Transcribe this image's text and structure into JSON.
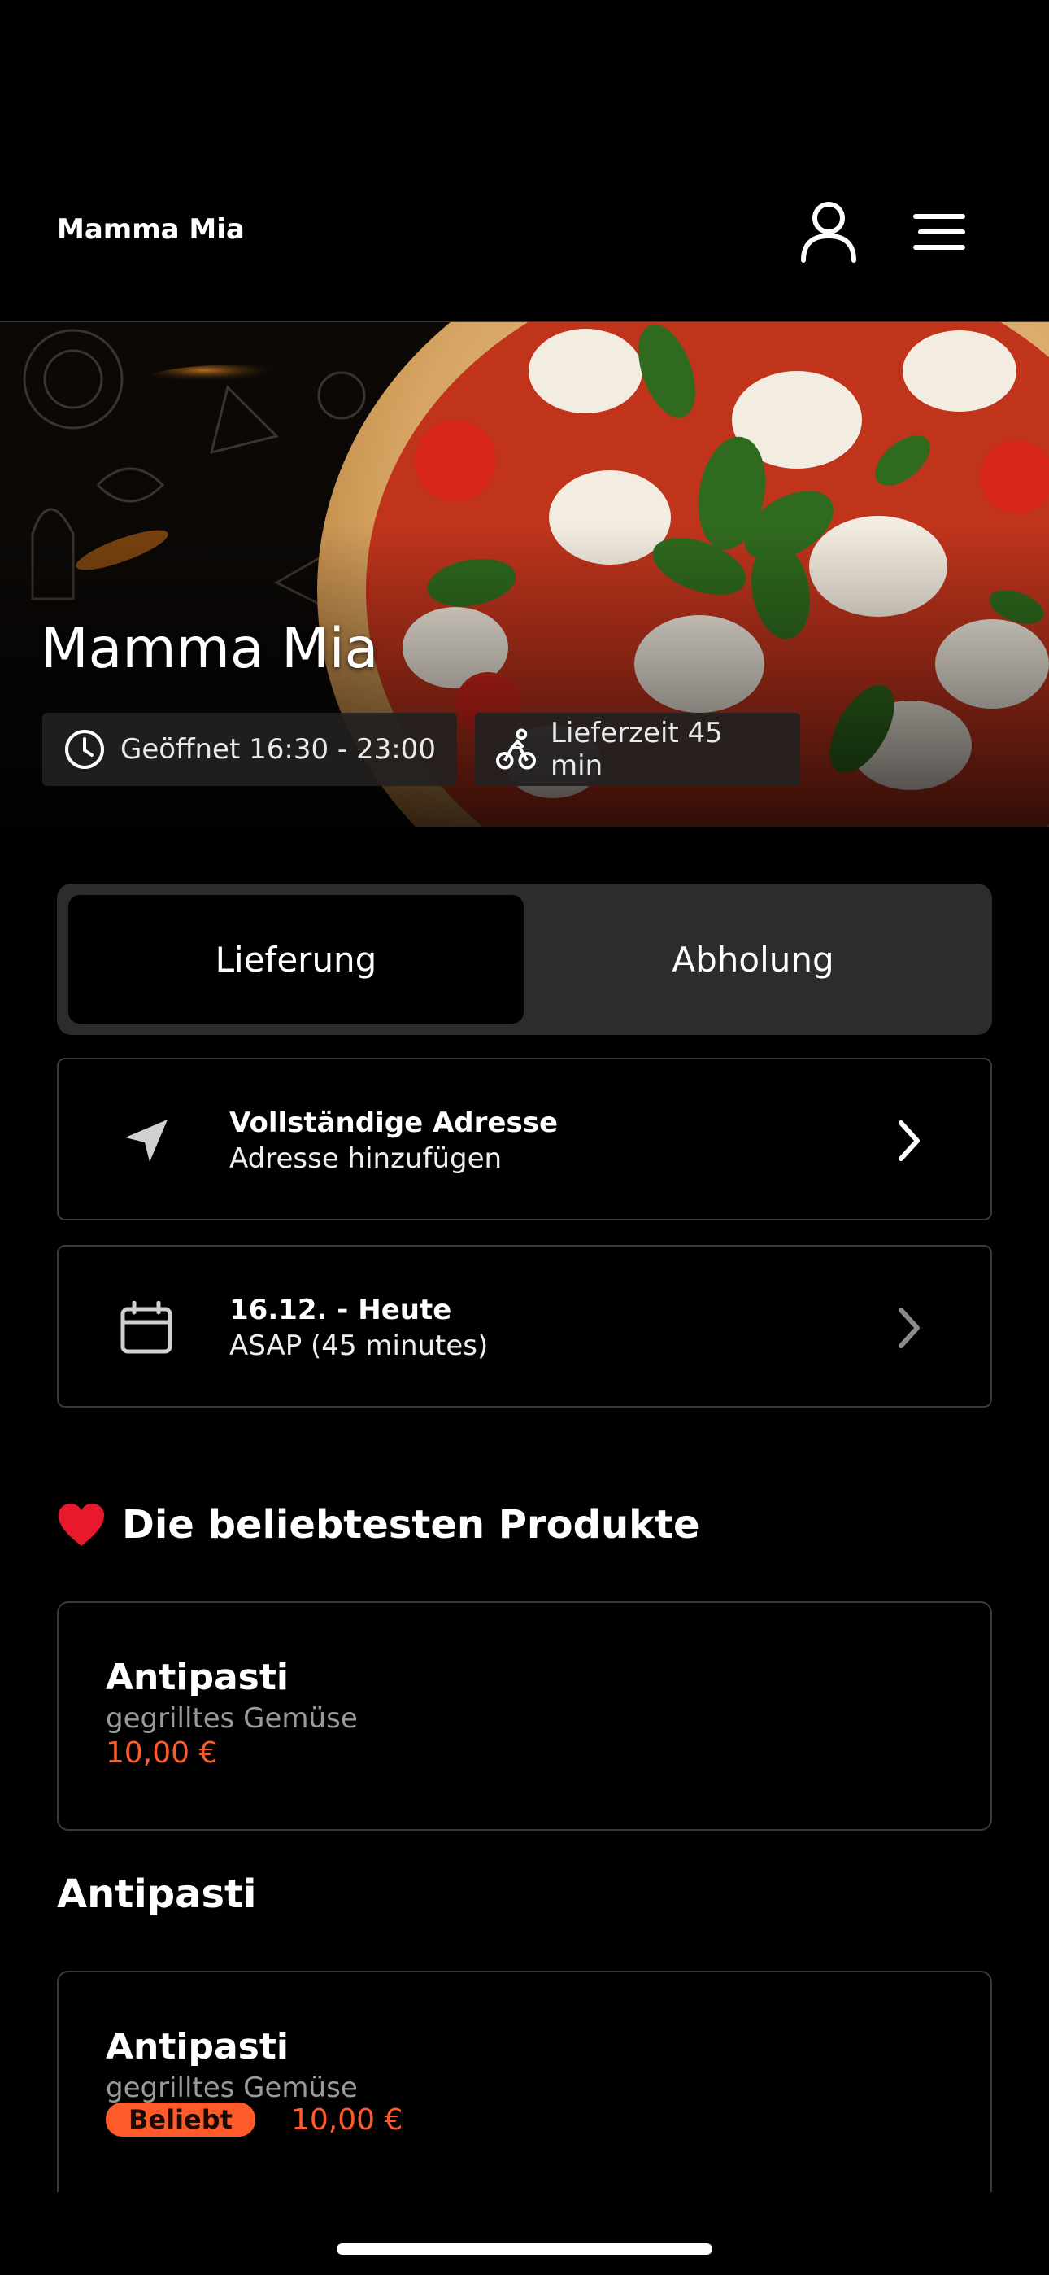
{
  "header": {
    "brand": "Mamma Mia",
    "user_icon": "user-icon",
    "menu_icon": "hamburger-menu-icon"
  },
  "hero": {
    "title": "Mamma Mia",
    "hours": "Geöffnet 16:30 - 23:00",
    "delivery_time": "Lieferzeit 45 min",
    "hours_icon": "clock-icon",
    "delivery_icon": "bicycle-icon"
  },
  "mode_toggle": {
    "options": [
      "Lieferung",
      "Abholung"
    ],
    "selected": "Lieferung"
  },
  "address_card": {
    "icon": "navigation-arrow-icon",
    "title": "Vollständige Adresse",
    "subtitle": "Adresse hinzufügen"
  },
  "time_card": {
    "icon": "calendar-icon",
    "title": "16.12. - Heute",
    "subtitle": "ASAP (45 minutes)"
  },
  "popular": {
    "title": "Die beliebtesten Produkte",
    "icon": "heart-icon",
    "items": [
      {
        "name": "Antipasti",
        "description": "gegrilltes Gemüse",
        "price": "10,00 €"
      }
    ]
  },
  "category": {
    "title": "Antipasti",
    "items": [
      {
        "name": "Antipasti",
        "description": "gegrilltes Gemüse",
        "badge": "Beliebt",
        "price": "10,00 €"
      }
    ]
  },
  "colors": {
    "accent": "#ff5a2a",
    "background": "#000000",
    "card_border": "#3a3a3a",
    "toggle_bg": "#2c2c2c"
  }
}
